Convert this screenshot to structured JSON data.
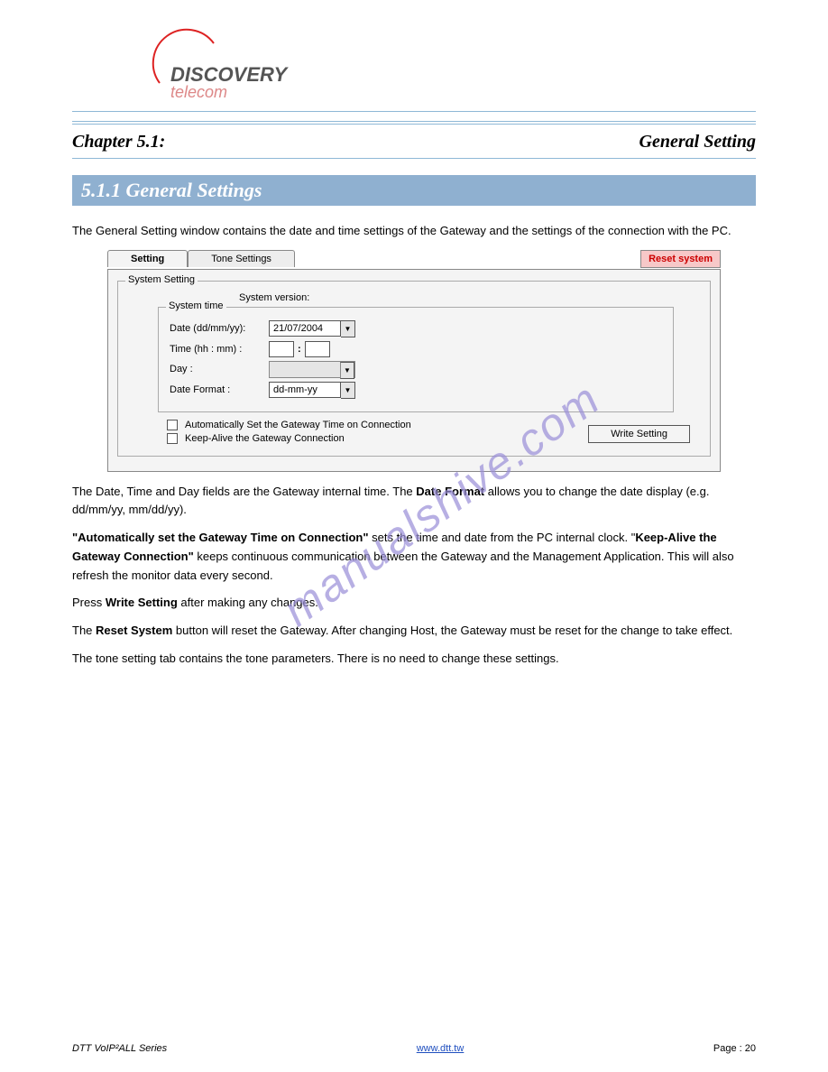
{
  "logo": {
    "top": "DISCOVERY",
    "bottom": "telecom"
  },
  "chapter": {
    "left": "Chapter 5.1:",
    "right": "General Setting"
  },
  "section_title": "5.1.1  General Settings",
  "intro": "The General Setting window contains the date and time settings of the Gateway and the settings of the connection with the PC.",
  "ui": {
    "tabs": {
      "setting": "Setting",
      "tone": "Tone Settings"
    },
    "reset": "Reset system",
    "group_title": "System Setting",
    "system_version_label": "System version:",
    "inner_group_title": "System time",
    "fields": {
      "date_label": "Date (dd/mm/yy):",
      "date_value": "21/07/2004",
      "time_label": "Time (hh : mm) :",
      "day_label": "Day :",
      "format_label": "Date Format :",
      "format_value": "dd-mm-yy"
    },
    "checks": {
      "auto": "Automatically Set the Gateway Time on Connection",
      "keep": "Keep-Alive the Gateway Connection"
    },
    "write_btn": "Write Setting"
  },
  "body": {
    "p1a": "The Date, Time and Day fields are the Gateway internal time. The ",
    "p1b": "Date Format",
    "p1c": " allows you to change the date display (e.g. dd/mm/yy, mm/dd/yy).",
    "p2a": "\"Automatically set the Gateway Time on Connection\"",
    "p2b": " sets the time and date from the PC internal clock. \"",
    "p2c": "Keep-Alive the Gateway Connection\"",
    "p2d": " keeps continuous communication between the Gateway and the Management Application. This will also refresh the monitor data every second.",
    "p3a": "Press ",
    "p3b": "Write Setting",
    "p3c": " after making any changes.",
    "p4a": "The ",
    "p4b": "Reset System",
    "p4c": " button will reset the Gateway. After changing Host, the Gateway must be reset for the change to take effect.",
    "p5": "The tone setting tab contains the tone parameters. There is no need to change these settings."
  },
  "watermark": "manualshive.com",
  "footer": {
    "left": "DTT VoIP²ALL Series",
    "link": "www.dtt.tw",
    "right": "Page : 20"
  }
}
